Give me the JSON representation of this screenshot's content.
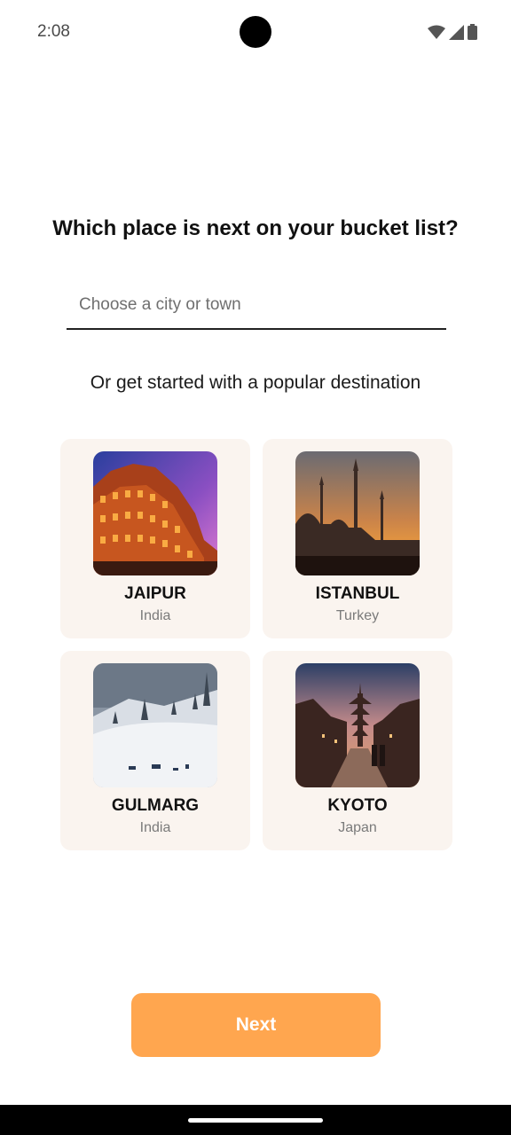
{
  "status_bar": {
    "time": "2:08",
    "icons": [
      "wifi-icon",
      "cell-signal-icon",
      "battery-icon"
    ]
  },
  "heading": "Which place is next on your bucket list?",
  "search": {
    "placeholder": "Choose a city or town",
    "value": ""
  },
  "subheading": "Or get started with a popular destination",
  "destinations": [
    {
      "city": "JAIPUR",
      "country": "India",
      "image": "jaipur-photo"
    },
    {
      "city": "ISTANBUL",
      "country": "Turkey",
      "image": "istanbul-photo"
    },
    {
      "city": "GULMARG",
      "country": "India",
      "image": "gulmarg-photo"
    },
    {
      "city": "KYOTO",
      "country": "Japan",
      "image": "kyoto-photo"
    }
  ],
  "next_button": {
    "label": "Next"
  },
  "colors": {
    "accent": "#ffa64f",
    "card_bg": "#faf4ef"
  }
}
